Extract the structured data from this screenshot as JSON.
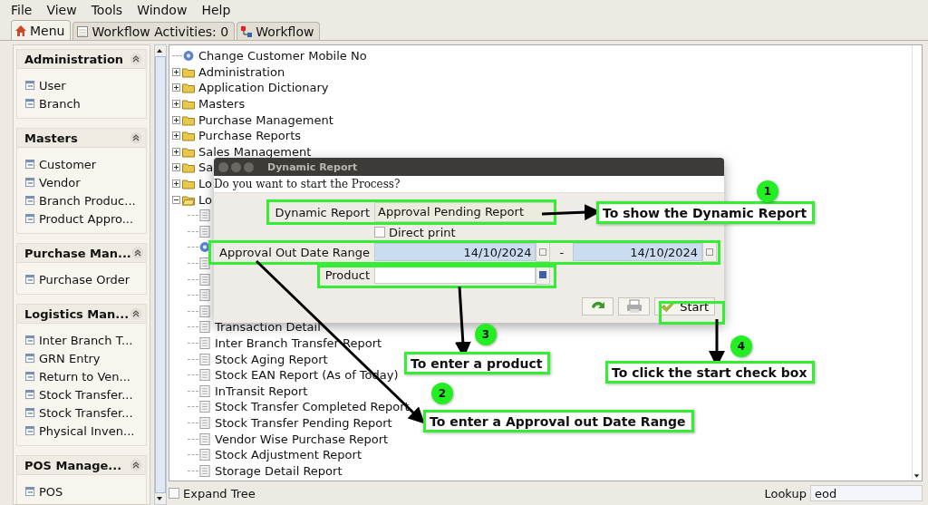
{
  "menubar": [
    "File",
    "View",
    "Tools",
    "Window",
    "Help"
  ],
  "tabs": [
    {
      "label": "Menu",
      "kind": "home",
      "selected": true
    },
    {
      "label": "Workflow Activities: 0",
      "kind": "list",
      "selected": false
    },
    {
      "label": "Workflow",
      "kind": "flow",
      "selected": false
    }
  ],
  "sidebar": {
    "sections": [
      {
        "title": "Administration",
        "expanded": true,
        "items": [
          "User",
          "Branch"
        ]
      },
      {
        "title": "Masters",
        "expanded": true,
        "items": [
          "Customer",
          "Vendor",
          "Branch Produc...",
          "Product Appro..."
        ]
      },
      {
        "title": "Purchase Man...",
        "expanded": true,
        "items": [
          "Purchase Order"
        ]
      },
      {
        "title": "Logistics Man...",
        "expanded": true,
        "items": [
          "Inter Branch T...",
          "GRN Entry",
          "Return to Ven...",
          "Stock Transfer...",
          "Stock Transfer...",
          "Physical Inven..."
        ]
      },
      {
        "title": "POS Manage...",
        "expanded": true,
        "items": [
          "POS"
        ]
      }
    ]
  },
  "tree": {
    "items": [
      {
        "label": "Change Customer Mobile No",
        "kind": "process"
      },
      {
        "label": "Administration",
        "kind": "folder",
        "expanded": false
      },
      {
        "label": "Application Dictionary",
        "kind": "folder",
        "expanded": false
      },
      {
        "label": "Masters",
        "kind": "folder",
        "expanded": false
      },
      {
        "label": "Purchase Management",
        "kind": "folder",
        "expanded": false
      },
      {
        "label": "Purchase Reports",
        "kind": "folder",
        "expanded": false
      },
      {
        "label": "Sales Management",
        "kind": "folder",
        "expanded": false
      },
      {
        "label": "Sa",
        "kind": "folder",
        "expanded": false
      },
      {
        "label": "Lo",
        "kind": "folder",
        "expanded": false
      },
      {
        "label": "Lo",
        "kind": "folder",
        "expanded": true,
        "children": [
          {
            "kind": "report"
          },
          {
            "kind": "report"
          },
          {
            "kind": "process"
          },
          {
            "kind": "report"
          },
          {
            "kind": "report"
          },
          {
            "kind": "report"
          },
          {
            "kind": "report"
          },
          {
            "label": "Transaction Detail",
            "kind": "report"
          },
          {
            "label": "Inter Branch Transfer Report",
            "kind": "report"
          },
          {
            "label": "Stock Aging Report",
            "kind": "report"
          },
          {
            "label": "Stock EAN Report (As of Today)",
            "kind": "report"
          },
          {
            "label": "InTransit Report",
            "kind": "report"
          },
          {
            "label": "Stock Transfer Completed Report",
            "kind": "report"
          },
          {
            "label": "Stock Transfer Pending Report",
            "kind": "report"
          },
          {
            "label": "Vendor Wise Purchase Report",
            "kind": "report"
          },
          {
            "label": "Stock Adjustment Report",
            "kind": "report"
          },
          {
            "label": "Storage Detail Report",
            "kind": "report"
          }
        ]
      }
    ]
  },
  "dialog": {
    "title": "Dynamic Report",
    "question": "Do you want to start the Process?",
    "report": {
      "label": "Dynamic Report",
      "value": "Approval Pending Report"
    },
    "direct_print": {
      "label": "Direct print",
      "checked": false
    },
    "date_range": {
      "label": "Approval Out Date Range",
      "from": "14/10/2024",
      "separator": "-",
      "to": "14/10/2024"
    },
    "product": {
      "label": "Product"
    },
    "buttons": [
      {
        "kind": "refresh"
      },
      {
        "kind": "print"
      },
      {
        "kind": "start",
        "label": "Start"
      }
    ]
  },
  "annotations": [
    {
      "number": "1",
      "text": "To show the Dynamic Report"
    },
    {
      "number": "3",
      "text": "To enter a product"
    },
    {
      "number": "4",
      "text": "To click the start check box"
    },
    {
      "number": "2",
      "text": "To enter a Approval out Date Range"
    }
  ],
  "bottom": {
    "expand_tree": {
      "label": "Expand Tree",
      "checked": false
    },
    "lookup": {
      "label": "Lookup",
      "value": "eod"
    }
  }
}
